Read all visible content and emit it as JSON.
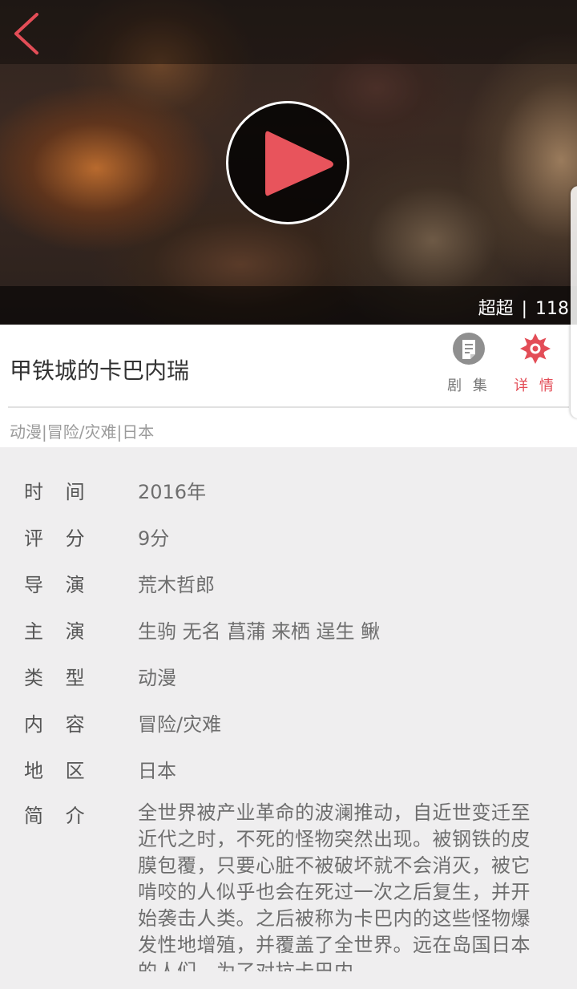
{
  "video": {
    "source_label": "超超",
    "separator": "|",
    "count": "118"
  },
  "show": {
    "title": "甲铁城的卡巴内瑞",
    "genre_line": "动漫|冒险/灾难|日本"
  },
  "tabs": {
    "episodes_label": "剧 集",
    "details_label": "详 情"
  },
  "details": [
    {
      "label": "时 间",
      "value": "2016年"
    },
    {
      "label": "评 分",
      "value": "9分"
    },
    {
      "label": "导 演",
      "value": "荒木哲郎"
    },
    {
      "label": "主 演",
      "value": "生驹 无名 菖蒲 来栖 逞生 鳅"
    },
    {
      "label": "类 型",
      "value": "动漫"
    },
    {
      "label": "内 容",
      "value": "冒险/灾难"
    },
    {
      "label": "地 区",
      "value": "日本"
    }
  ],
  "synopsis": {
    "label": "简 介",
    "text": "全世界被产业革命的波澜推动，自近世变迁至近代之时，不死的怪物突然出现。被钢铁的皮膜包覆，只要心脏不被破坏就不会消灭，被它啃咬的人似乎也会在死过一次之后复生，并开始袭击人类。之后被称为卡巴内的这些怪物爆发性地增殖，并覆盖了全世界。远在岛国日本的人们，为了对抗卡巴内"
  },
  "colors": {
    "accent": "#e34d57",
    "play": "#e8545c",
    "background": "#efeeef"
  },
  "icons": {
    "back": "chevron-left-icon",
    "play": "play-icon",
    "episodes": "list-icon",
    "details": "gear-icon"
  }
}
